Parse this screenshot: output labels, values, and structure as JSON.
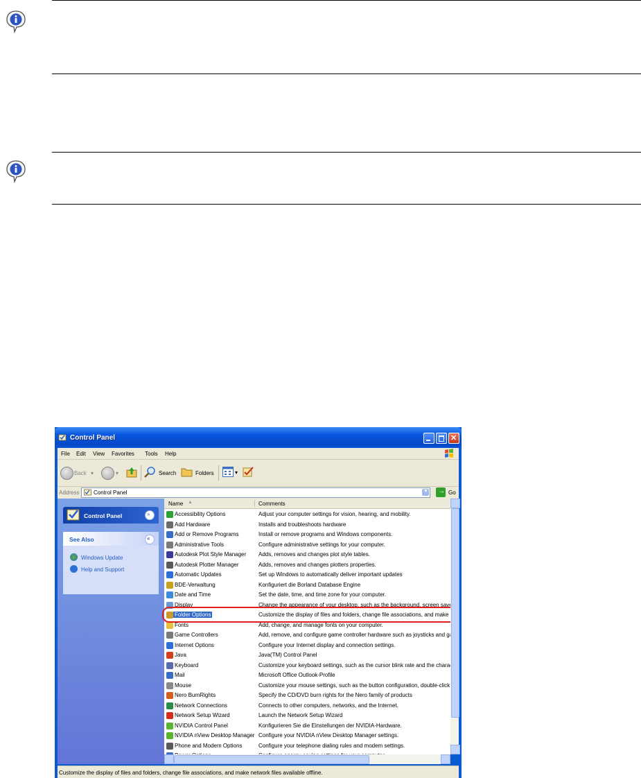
{
  "window": {
    "title": "Control Panel",
    "menu": [
      "File",
      "Edit",
      "View",
      "Favorites",
      "Tools",
      "Help"
    ],
    "toolbar": {
      "back": "Back",
      "search": "Search",
      "folders": "Folders"
    },
    "address": {
      "label": "Address",
      "value": "Control Panel",
      "go": "Go"
    }
  },
  "task_pane": {
    "header": "Control Panel",
    "see_also": {
      "title": "See Also",
      "links": [
        "Windows Update",
        "Help and Support"
      ]
    }
  },
  "list": {
    "columns": [
      "Name",
      "Comments"
    ],
    "rows": [
      {
        "name": "Accessibility Options",
        "comment": "Adjust your computer settings for vision, hearing, and mobility."
      },
      {
        "name": "Add Hardware",
        "comment": "Installs and troubleshoots hardware"
      },
      {
        "name": "Add or Remove Programs",
        "comment": "Install or remove programs and Windows components."
      },
      {
        "name": "Administrative Tools",
        "comment": "Configure administrative settings for your computer."
      },
      {
        "name": "Autodesk Plot Style Manager",
        "comment": "Adds, removes and changes plot style tables."
      },
      {
        "name": "Autodesk Plotter Manager",
        "comment": "Adds, removes and changes plotters properties."
      },
      {
        "name": "Automatic Updates",
        "comment": "Set up Windows to automatically deliver important updates"
      },
      {
        "name": "BDE-Verwaltung",
        "comment": "Konfiguriert die Borland Database Engine"
      },
      {
        "name": "Date and Time",
        "comment": "Set the date, time, and time zone for your computer."
      },
      {
        "name": "Display",
        "comment": "Change the appearance of your desktop, such as the background, screen save"
      },
      {
        "name": "Folder Options",
        "comment": "Customize the display of files and folders, change file associations, and make n"
      },
      {
        "name": "Fonts",
        "comment": "Add, change, and manage fonts on your computer."
      },
      {
        "name": "Game Controllers",
        "comment": "Add, remove, and configure game controller hardware such as joysticks and ga"
      },
      {
        "name": "Internet Options",
        "comment": "Configure your Internet display and connection settings."
      },
      {
        "name": "Java",
        "comment": "Java(TM) Control Panel"
      },
      {
        "name": "Keyboard",
        "comment": "Customize your keyboard settings, such as the cursor blink rate and the charac"
      },
      {
        "name": "Mail",
        "comment": "Microsoft Office Outlook-Profile"
      },
      {
        "name": "Mouse",
        "comment": "Customize your mouse settings, such as the button configuration, double-click s"
      },
      {
        "name": "Nero BurnRights",
        "comment": "Specify the CD/DVD burn rights for the Nero family of products"
      },
      {
        "name": "Network Connections",
        "comment": "Connects to other computers, networks, and the Internet."
      },
      {
        "name": "Network Setup Wizard",
        "comment": "Launch the Network Setup Wizard"
      },
      {
        "name": "NVIDIA Control Panel",
        "comment": "Konfigurieren Sie die Einstellungen der NVIDIA-Hardware."
      },
      {
        "name": "NVIDIA nView Desktop Manager",
        "comment": "Configure your NVIDIA nView Desktop Manager settings."
      },
      {
        "name": "Phone and Modem Options",
        "comment": "Configure your telephone dialing rules and modem settings."
      },
      {
        "name": "Power Options",
        "comment": "Configure energy-saving settings for your computer."
      }
    ],
    "selected": "Folder Options"
  },
  "status": "Customize the display of files and folders, change file associations, and make network files available offline.",
  "colors": {
    "accent": "#0a5ad2",
    "selection": "#316ac5",
    "highlight_oval": "#e21d1d",
    "task_pane_link": "#215dc6"
  },
  "icons": [
    "info-note-icon",
    "control-panel-icon",
    "windows-logo-icon",
    "back-icon",
    "forward-icon",
    "up-folder-icon",
    "search-icon",
    "folders-icon",
    "views-icon",
    "go-icon"
  ]
}
